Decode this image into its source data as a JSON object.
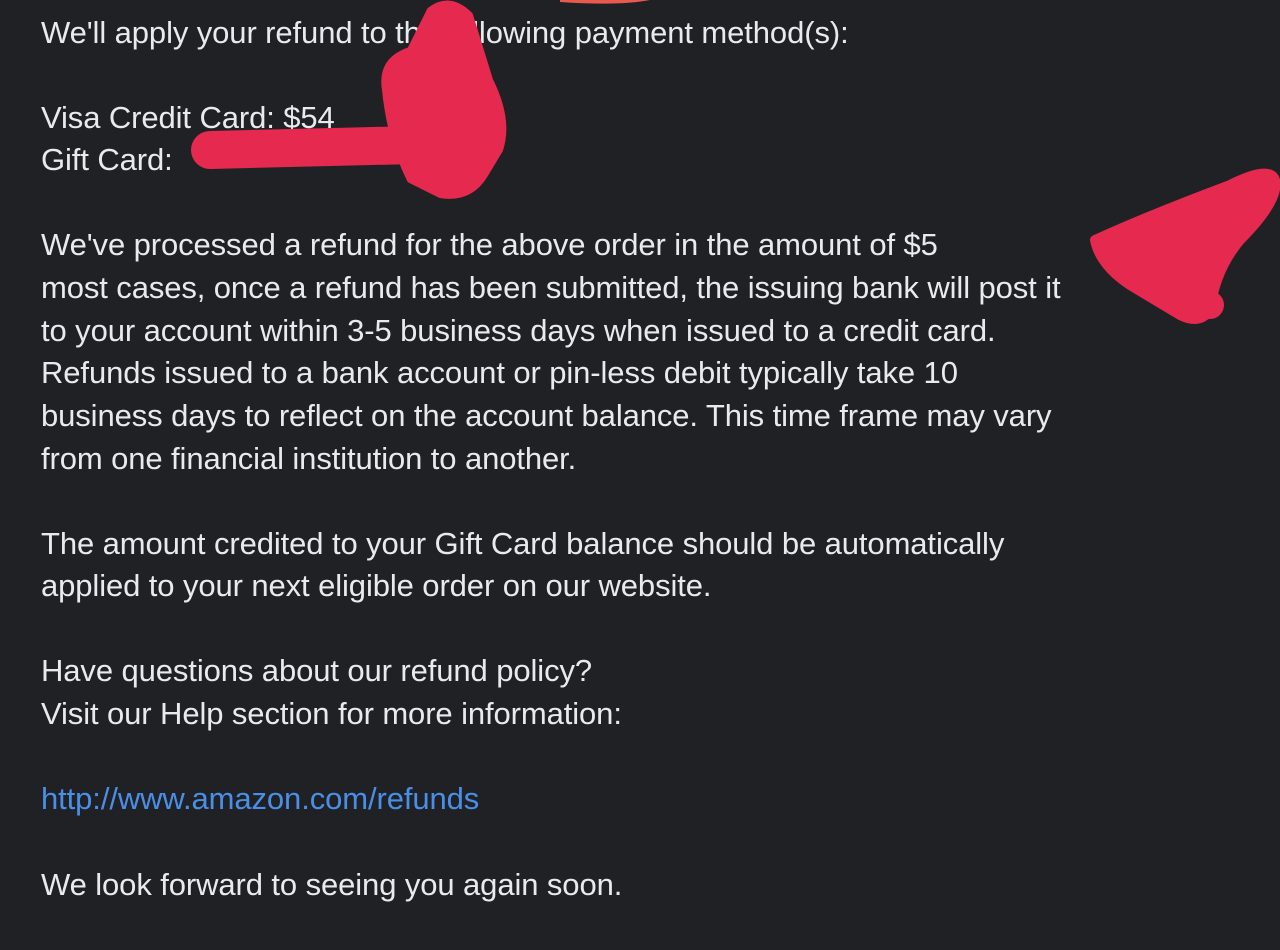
{
  "email": {
    "intro": "We'll apply your refund to the following payment method(s):",
    "visa_line": "Visa Credit Card: $54",
    "gift_line": "Gift Card: ",
    "processed": [
      "We've processed a refund for the above order in the amount of $5",
      "most cases, once a refund has been submitted, the issuing bank will post it",
      "to your account within 3-5 business days when issued to a credit card.",
      "Refunds issued to a bank account or pin-less debit typically take 10",
      "business days to reflect on the account balance. This time frame may vary",
      "from one financial institution to another."
    ],
    "gift_note": [
      "The amount credited to your Gift Card balance should be automatically",
      "applied to your next eligible order on our website."
    ],
    "questions": [
      "Have questions about our refund policy?",
      "Visit our Help section for more information:"
    ],
    "help_link": "http://www.amazon.com/refunds",
    "closing": "We look forward to seeing you again soon."
  },
  "colors": {
    "background": "#202124",
    "text": "#e8eaed",
    "link": "#4a8fe7",
    "redaction": "#e5294f"
  }
}
